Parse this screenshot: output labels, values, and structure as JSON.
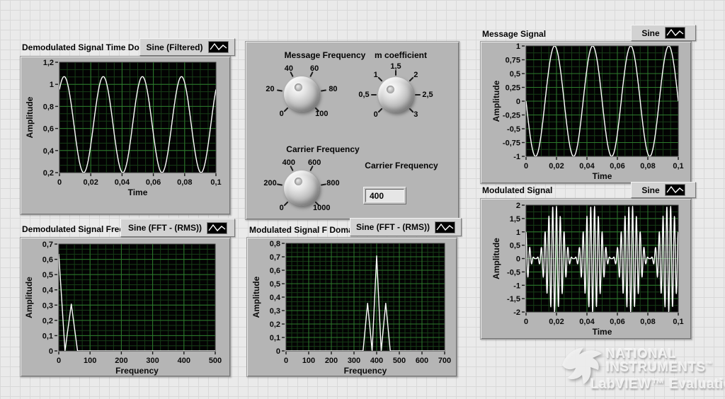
{
  "theme": {
    "window_bg": "#eaeaea",
    "panel_bg": "#b5b5b5",
    "plot_bg": "#030303",
    "grid_minor": "#173d17",
    "grid_major": "#2c7a2c",
    "trace": "#ffffff",
    "legend_plate_bg": "#d2d2d2"
  },
  "controls": {
    "knobs": [
      {
        "id": "message-frequency",
        "label": "Message Frequency",
        "value": 40,
        "indicator_angle": 117,
        "scale": [
          {
            "text": "0",
            "angle": 225
          },
          {
            "text": "20",
            "angle": 171
          },
          {
            "text": "40",
            "angle": 117
          },
          {
            "text": "60",
            "angle": 63
          },
          {
            "text": "80",
            "angle": 9
          },
          {
            "text": "100",
            "angle": 315
          }
        ]
      },
      {
        "id": "m-coefficient",
        "label": "m coefficient",
        "value": 1,
        "indicator_angle": 135,
        "scale": [
          {
            "text": "0",
            "angle": 225
          },
          {
            "text": "0,5",
            "angle": 180
          },
          {
            "text": "1",
            "angle": 135
          },
          {
            "text": "1,5",
            "angle": 90
          },
          {
            "text": "2",
            "angle": 45
          },
          {
            "text": "2,5",
            "angle": 0
          },
          {
            "text": "3",
            "angle": 315
          }
        ]
      },
      {
        "id": "carrier-frequency",
        "label": "Carrier Frequency",
        "value": 400,
        "indicator_angle": 117,
        "scale": [
          {
            "text": "0",
            "angle": 225
          },
          {
            "text": "200",
            "angle": 171
          },
          {
            "text": "400",
            "angle": 117
          },
          {
            "text": "600",
            "angle": 63
          },
          {
            "text": "800",
            "angle": 9
          },
          {
            "text": "1000",
            "angle": 315
          }
        ]
      }
    ],
    "numeric_display": {
      "label": "Carrier Frequency",
      "value": "400"
    }
  },
  "watermark": {
    "line1": "NATIONAL",
    "line2": "INSTRUMENTS",
    "trademark": "™",
    "line3": "LabVIEW™ Evaluation"
  },
  "chart_data": [
    {
      "id": "demodulated-time-domain",
      "type": "line",
      "title": "Demodulated Signal Time Domain",
      "legend": "Sine (Filtered)",
      "legend_icon": "waveform-line-icon",
      "xlabel": "Time",
      "ylabel": "Amplitude",
      "xlim": [
        0,
        0.1
      ],
      "ylim": [
        0.2,
        1.2
      ],
      "xticks": [
        0,
        0.02,
        0.04,
        0.06,
        0.08,
        0.1
      ],
      "yticks": [
        0.2,
        0.4,
        0.6,
        0.8,
        1,
        1.2
      ],
      "minor_div": {
        "x": 4,
        "y": 3
      },
      "grid": true,
      "signal": {
        "kind": "sine",
        "offset": 0.635,
        "amplitude": 0.435,
        "freq_hz": 40,
        "phase_deg": 47,
        "samples": 500
      }
    },
    {
      "id": "message-signal",
      "type": "line",
      "title": "Message Signal",
      "legend": "Sine",
      "legend_icon": "waveform-line-icon",
      "xlabel": "Time",
      "ylabel": "Amplitude",
      "xlim": [
        0,
        0.1
      ],
      "ylim": [
        -1,
        1
      ],
      "xticks": [
        0,
        0.02,
        0.04,
        0.06,
        0.08,
        0.1
      ],
      "yticks": [
        -1,
        -0.75,
        -0.5,
        -0.25,
        0,
        0.25,
        0.5,
        0.75,
        1
      ],
      "minor_div": {
        "x": 4,
        "y": 2
      },
      "grid": true,
      "signal": {
        "kind": "sine",
        "offset": 0,
        "amplitude": 1,
        "freq_hz": 40,
        "phase_deg": 180,
        "samples": 500
      }
    },
    {
      "id": "modulated-signal",
      "type": "line",
      "title": "Modulated Signal",
      "legend": "Sine",
      "legend_icon": "waveform-line-icon",
      "xlabel": "Time",
      "ylabel": "Amplitude",
      "xlim": [
        0,
        0.1
      ],
      "ylim": [
        -2,
        2
      ],
      "xticks": [
        0,
        0.02,
        0.04,
        0.06,
        0.08,
        0.1
      ],
      "yticks": [
        -2,
        -1.5,
        -1,
        -0.5,
        0,
        0.5,
        1,
        1.5,
        2
      ],
      "minor_div": {
        "x": 4,
        "y": 2
      },
      "grid": true,
      "signal": {
        "kind": "am",
        "carrier_hz": 400,
        "carrier_phase_deg": 90,
        "message_hz": 40,
        "message_phase_deg": 180,
        "m": 1,
        "samples": 700
      }
    },
    {
      "id": "demodulated-frequency-domain",
      "type": "line",
      "title": "Demodulated Signal Frequency Domain",
      "legend": "Sine (FFT - (RMS))",
      "legend_icon": "waveform-line-icon",
      "xlabel": "Frequency",
      "ylabel": "Amplitude",
      "xlim": [
        0,
        500
      ],
      "ylim": [
        0,
        0.7
      ],
      "xticks": [
        0,
        100,
        200,
        300,
        400,
        500
      ],
      "yticks": [
        0,
        0.1,
        0.2,
        0.3,
        0.4,
        0.5,
        0.6,
        0.7
      ],
      "minor_div": {
        "x": 4,
        "y": 3
      },
      "grid": true,
      "points": [
        [
          0,
          0.635
        ],
        [
          20,
          0
        ],
        [
          40,
          0.307
        ],
        [
          60,
          0
        ],
        [
          500,
          0
        ]
      ]
    },
    {
      "id": "modulated-f-domain",
      "type": "line",
      "title": "Modulated Signal F Domain",
      "legend": "Sine (FFT - (RMS))",
      "legend_icon": "waveform-line-icon",
      "xlabel": "Frequency",
      "ylabel": "Amplitude",
      "xlim": [
        0,
        700
      ],
      "ylim": [
        0,
        0.8
      ],
      "xticks": [
        0,
        100,
        200,
        300,
        400,
        500,
        600,
        700
      ],
      "yticks": [
        0,
        0.1,
        0.2,
        0.3,
        0.4,
        0.5,
        0.6,
        0.7,
        0.8
      ],
      "minor_div": {
        "x": 4,
        "y": 3
      },
      "grid": true,
      "points": [
        [
          0,
          0
        ],
        [
          340,
          0
        ],
        [
          360,
          0.354
        ],
        [
          380,
          0
        ],
        [
          400,
          0.707
        ],
        [
          420,
          0
        ],
        [
          440,
          0.354
        ],
        [
          460,
          0
        ],
        [
          700,
          0
        ]
      ]
    }
  ]
}
